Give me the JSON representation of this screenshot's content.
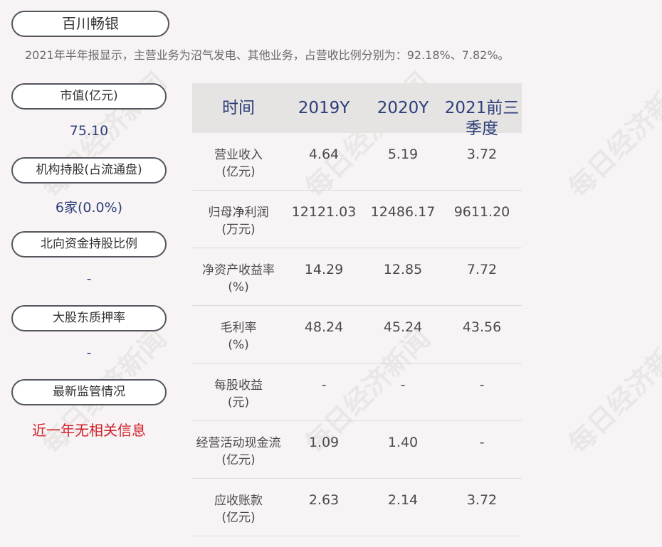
{
  "title": "百川畅银",
  "summary": "2021年半年报显示，主营业务为沼气发电、其他业务，占营收比例分别为：92.18%、7.82%。",
  "sidebar": [
    {
      "label": "市值(亿元)",
      "value": "75.10",
      "alert": false
    },
    {
      "label": "机构持股(占流通盘)",
      "value": "6家(0.0%)",
      "alert": false
    },
    {
      "label": "北向资金持股比例",
      "value": "-",
      "alert": false
    },
    {
      "label": "大股东质押率",
      "value": "-",
      "alert": false
    },
    {
      "label": "最新监管情况",
      "value": "近一年无相关信息",
      "alert": true
    }
  ],
  "table": {
    "headers": [
      "时间",
      "2019Y",
      "2020Y",
      "2021前三季度"
    ],
    "rows": [
      {
        "label": "营业收入(亿元)",
        "values": [
          "4.64",
          "5.19",
          "3.72"
        ]
      },
      {
        "label": "归母净利润(万元)",
        "values": [
          "12121.03",
          "12486.17",
          "9611.20"
        ]
      },
      {
        "label": "净资产收益率(%)",
        "values": [
          "14.29",
          "12.85",
          "7.72"
        ]
      },
      {
        "label": "毛利率(%)",
        "values": [
          "48.24",
          "45.24",
          "43.56"
        ]
      },
      {
        "label": "每股收益(元)",
        "values": [
          "-",
          "-",
          "-"
        ]
      },
      {
        "label": "经营活动现金流(亿元)",
        "values": [
          "1.09",
          "1.40",
          "-"
        ]
      },
      {
        "label": "应收账款(亿元)",
        "values": [
          "2.63",
          "2.14",
          "3.72"
        ]
      }
    ]
  },
  "watermark": "每日经济新闻",
  "colors": {
    "accent": "#2d3f7a",
    "alert": "#d0202a",
    "header_bg": "#e6e3e3",
    "page_bg": "#f8f4f5"
  }
}
